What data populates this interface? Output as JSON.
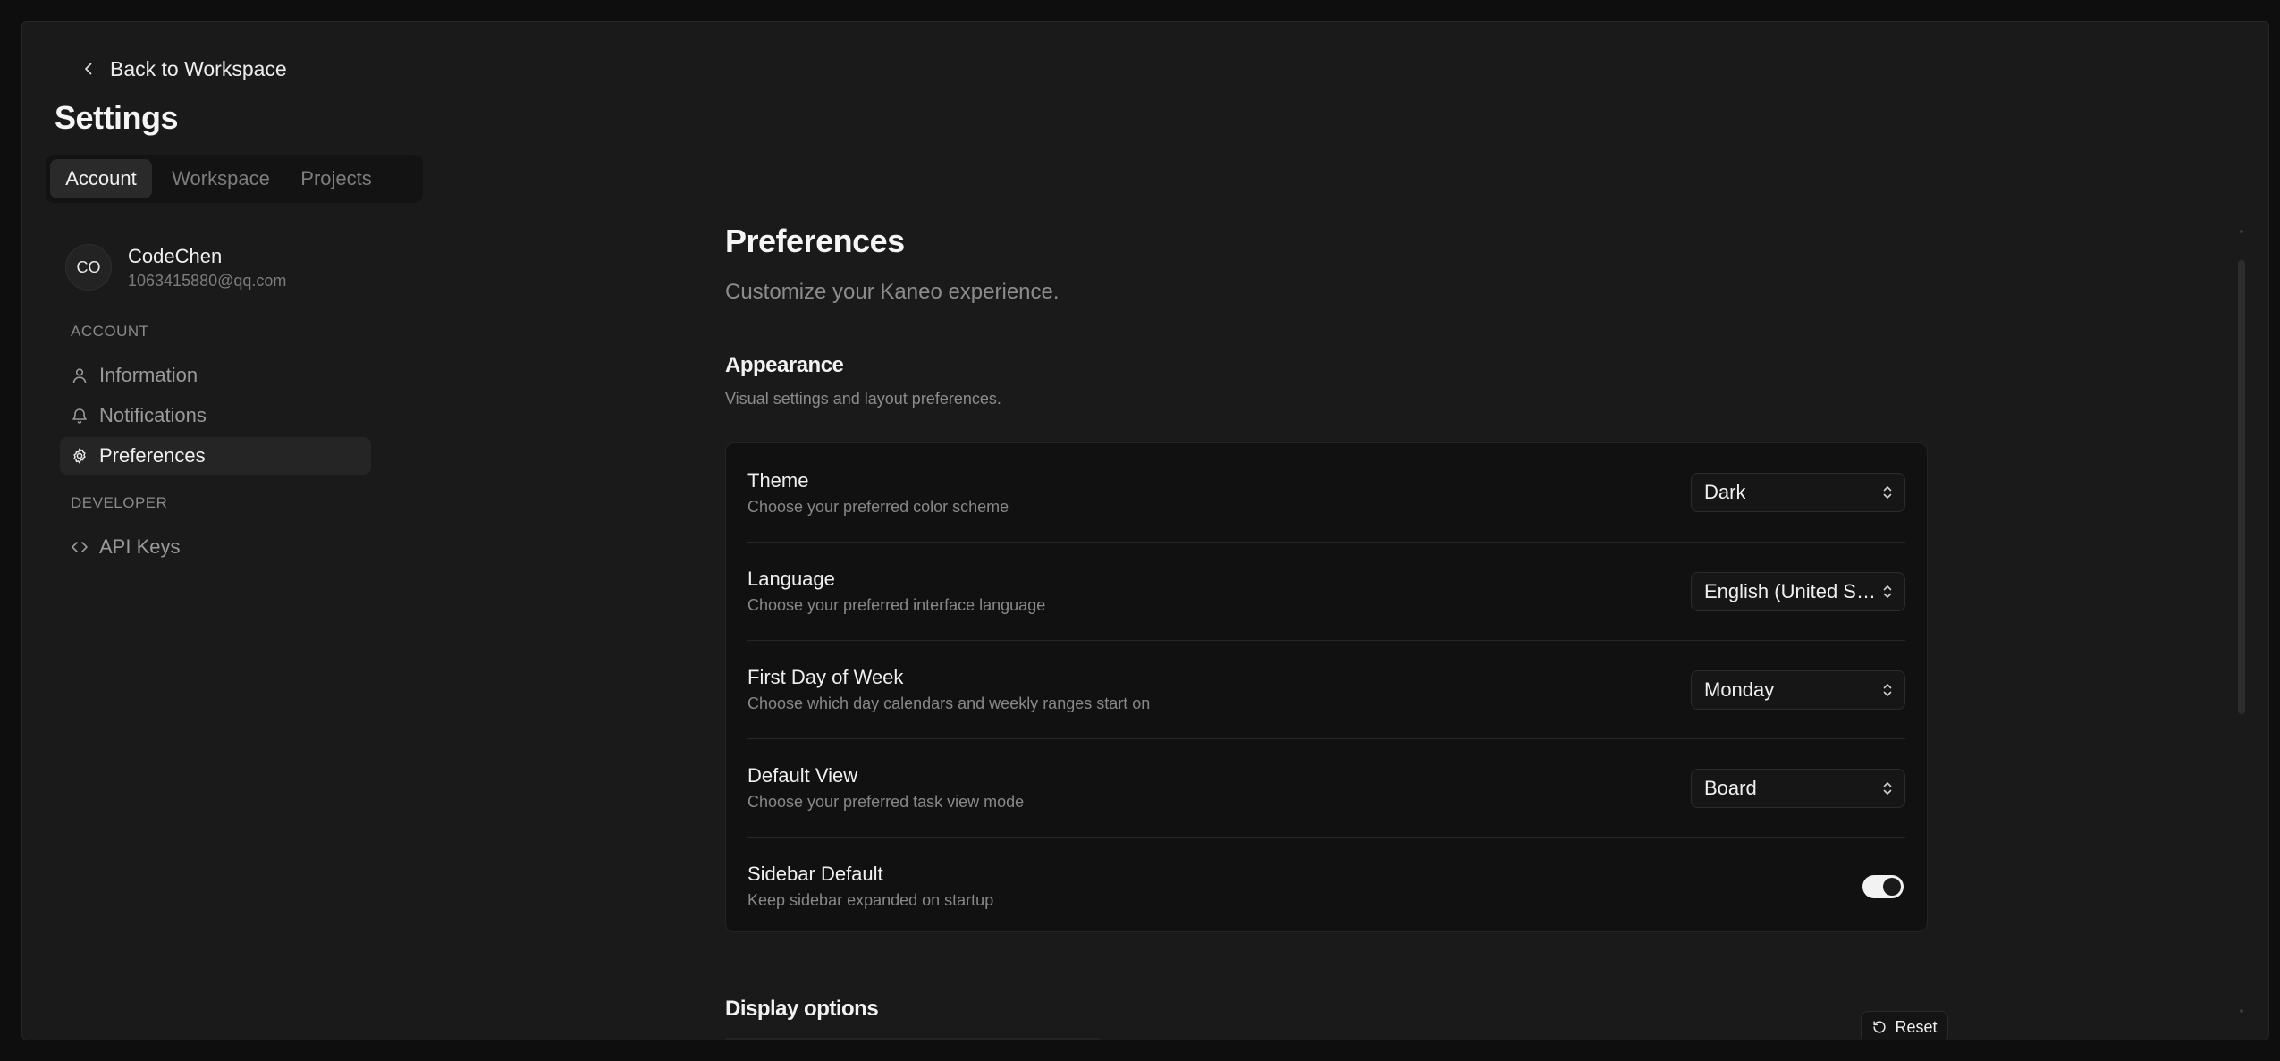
{
  "back": {
    "label": "Back to Workspace"
  },
  "header": {
    "title": "Settings"
  },
  "tabs": [
    {
      "label": "Account",
      "active": true
    },
    {
      "label": "Workspace",
      "active": false
    },
    {
      "label": "Projects",
      "active": false
    }
  ],
  "user": {
    "initials": "CO",
    "name": "CodeChen",
    "email": "1063415880@qq.com"
  },
  "sidebar": {
    "account_label": "ACCOUNT",
    "developer_label": "DEVELOPER",
    "items": [
      {
        "label": "Information",
        "icon": "user-icon"
      },
      {
        "label": "Notifications",
        "icon": "bell-icon"
      },
      {
        "label": "Preferences",
        "icon": "gear-icon",
        "active": true
      },
      {
        "label": "API Keys",
        "icon": "code-icon"
      }
    ]
  },
  "main": {
    "title": "Preferences",
    "subtitle": "Customize your Kaneo experience.",
    "appearance": {
      "title": "Appearance",
      "description": "Visual settings and layout preferences.",
      "rows": [
        {
          "title": "Theme",
          "description": "Choose your preferred color scheme",
          "value": "Dark"
        },
        {
          "title": "Language",
          "description": "Choose your preferred interface language",
          "value": "English (United States)"
        },
        {
          "title": "First Day of Week",
          "description": "Choose which day calendars and weekly ranges start on",
          "value": "Monday"
        },
        {
          "title": "Default View",
          "description": "Choose your preferred task view mode",
          "value": "Board"
        },
        {
          "title": "Sidebar Default",
          "description": "Keep sidebar expanded on startup",
          "toggle_on": true
        }
      ]
    },
    "display": {
      "title": "Display options",
      "reset_label": "Reset"
    }
  },
  "colors": {
    "background": "#1a1a1a",
    "card": "#111111",
    "accent": "#f2f2f2"
  }
}
